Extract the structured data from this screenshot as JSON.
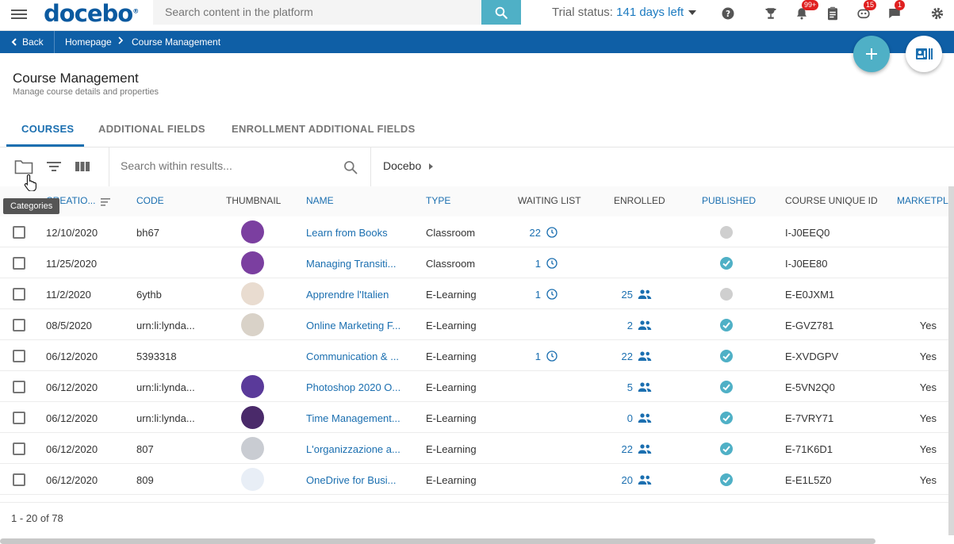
{
  "brand": {
    "logo": "docebo",
    "accent": "#0f5fa6",
    "teal": "#4fb0c6"
  },
  "topbar": {
    "search_placeholder": "Search content in the platform",
    "trial_label": "Trial status:",
    "trial_days": "141 days left",
    "badges": {
      "notifications": "99+",
      "chat_bot": "15",
      "messages": "1"
    }
  },
  "breadcrumb": {
    "back": "Back",
    "home": "Homepage",
    "current": "Course Management"
  },
  "page": {
    "title": "Course Management",
    "subtitle": "Manage course details and properties"
  },
  "tabs": [
    {
      "label": "COURSES"
    },
    {
      "label": "ADDITIONAL FIELDS"
    },
    {
      "label": "ENROLLMENT ADDITIONAL FIELDS"
    }
  ],
  "toolbar": {
    "search_placeholder": "Search within results...",
    "category": "Docebo",
    "tooltip": "Categories"
  },
  "columns": {
    "creation": "CREATIO...",
    "code": "CODE",
    "thumbnail": "THUMBNAIL",
    "name": "NAME",
    "type": "TYPE",
    "waiting": "WAITING LIST",
    "enrolled": "ENROLLED",
    "published": "PUBLISHED",
    "uid": "COURSE UNIQUE ID",
    "marketplace": "MARKETPLA"
  },
  "rows": [
    {
      "date": "12/10/2020",
      "code": "bh67",
      "name": "Learn from Books",
      "type": "Classroom",
      "waiting": "22",
      "enrolled": "",
      "published": false,
      "uid": "I-J0EEQ0",
      "market": "",
      "thumb": "#7b3fa0"
    },
    {
      "date": "11/25/2020",
      "code": "",
      "name": "Managing Transiti...",
      "type": "Classroom",
      "waiting": "1",
      "enrolled": "",
      "published": true,
      "uid": "I-J0EE80",
      "market": "",
      "thumb": "#7b3fa0"
    },
    {
      "date": "11/2/2020",
      "code": "6ythb",
      "name": "Apprendre l'Italien",
      "type": "E-Learning",
      "waiting": "1",
      "enrolled": "25",
      "published": false,
      "uid": "E-E0JXM1",
      "market": "",
      "thumb": "#e9dcd0"
    },
    {
      "date": "08/5/2020",
      "code": "urn:li:lynda...",
      "name": "Online Marketing F...",
      "type": "E-Learning",
      "waiting": "",
      "enrolled": "2",
      "published": true,
      "uid": "E-GVZ781",
      "market": "Yes",
      "thumb": "#d9d2c8"
    },
    {
      "date": "06/12/2020",
      "code": "5393318",
      "name": "Communication & ...",
      "type": "E-Learning",
      "waiting": "1",
      "enrolled": "22",
      "published": true,
      "uid": "E-XVDGPV",
      "market": "Yes",
      "thumb": "#ffffff"
    },
    {
      "date": "06/12/2020",
      "code": "urn:li:lynda...",
      "name": "Photoshop 2020 O...",
      "type": "E-Learning",
      "waiting": "",
      "enrolled": "5",
      "published": true,
      "uid": "E-5VN2Q0",
      "market": "Yes",
      "thumb": "#5a3a9a"
    },
    {
      "date": "06/12/2020",
      "code": "urn:li:lynda...",
      "name": "Time Management...",
      "type": "E-Learning",
      "waiting": "",
      "enrolled": "0",
      "published": true,
      "uid": "E-7VRY71",
      "market": "Yes",
      "thumb": "#4a2a6a"
    },
    {
      "date": "06/12/2020",
      "code": "807",
      "name": "L'organizzazione a...",
      "type": "E-Learning",
      "waiting": "",
      "enrolled": "22",
      "published": true,
      "uid": "E-71K6D1",
      "market": "Yes",
      "thumb": "#c9ccd2"
    },
    {
      "date": "06/12/2020",
      "code": "809",
      "name": "OneDrive for Busi...",
      "type": "E-Learning",
      "waiting": "",
      "enrolled": "20",
      "published": true,
      "uid": "E-E1L5Z0",
      "market": "Yes",
      "thumb": "#e8eef6"
    }
  ],
  "pager": "1 - 20 of 78"
}
